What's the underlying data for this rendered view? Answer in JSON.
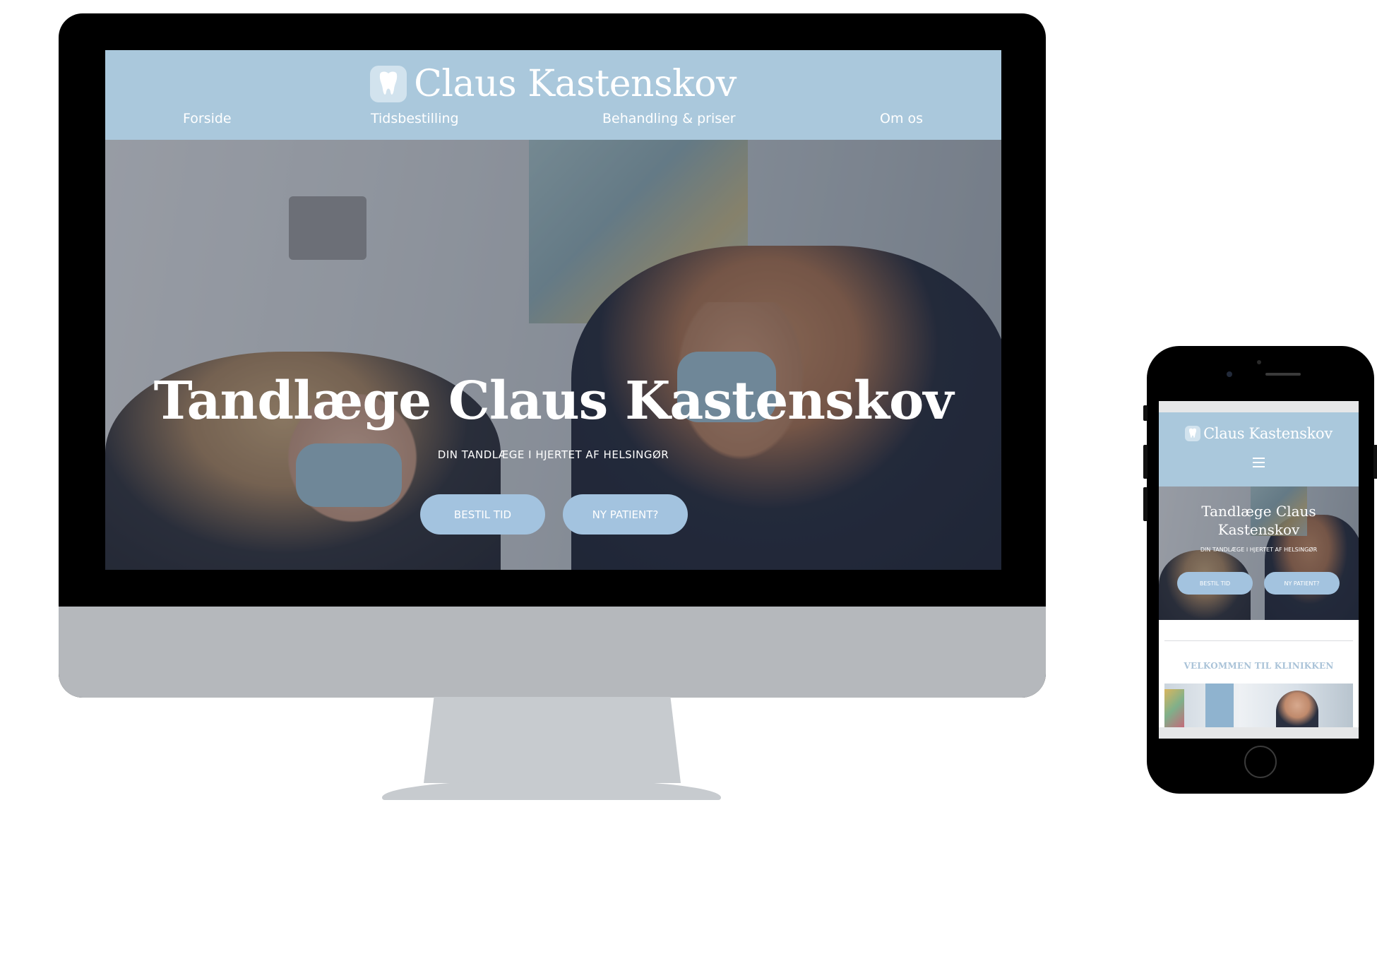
{
  "desktop": {
    "brand": {
      "name": "Claus Kastenskov",
      "logo_icon": "tooth-icon"
    },
    "nav": {
      "items": [
        {
          "label": "Forside"
        },
        {
          "label": "Tidsbestilling"
        },
        {
          "label": "Behandling & priser"
        },
        {
          "label": "Om os"
        }
      ]
    },
    "hero": {
      "title": "Tandlæge Claus Kastenskov",
      "subtitle": "DIN TANDLÆGE I HJERTET AF HELSINGØR",
      "buttons": [
        {
          "label": "BESTIL TID"
        },
        {
          "label": "NY PATIENT?"
        }
      ]
    }
  },
  "mobile": {
    "brand": {
      "name": "Claus Kastenskov",
      "logo_icon": "tooth-icon"
    },
    "menu_icon": "hamburger-menu-icon",
    "hero": {
      "title_line1": "Tandlæge Claus",
      "title_line2": "Kastenskov",
      "subtitle": "DIN TANDLÆGE I HJERTET AF HELSINGØR",
      "buttons": [
        {
          "label": "BESTIL TID"
        },
        {
          "label": "NY PATIENT?"
        }
      ]
    },
    "welcome_heading": "VELKOMMEN TIL KLINIKKEN"
  },
  "colors": {
    "header_blue": "#aac8dc",
    "button_blue": "#a3c3df",
    "welcome_text": "#aac3d8",
    "monitor_chin": "#b5b8bc",
    "stand": "#c7cbcf"
  }
}
